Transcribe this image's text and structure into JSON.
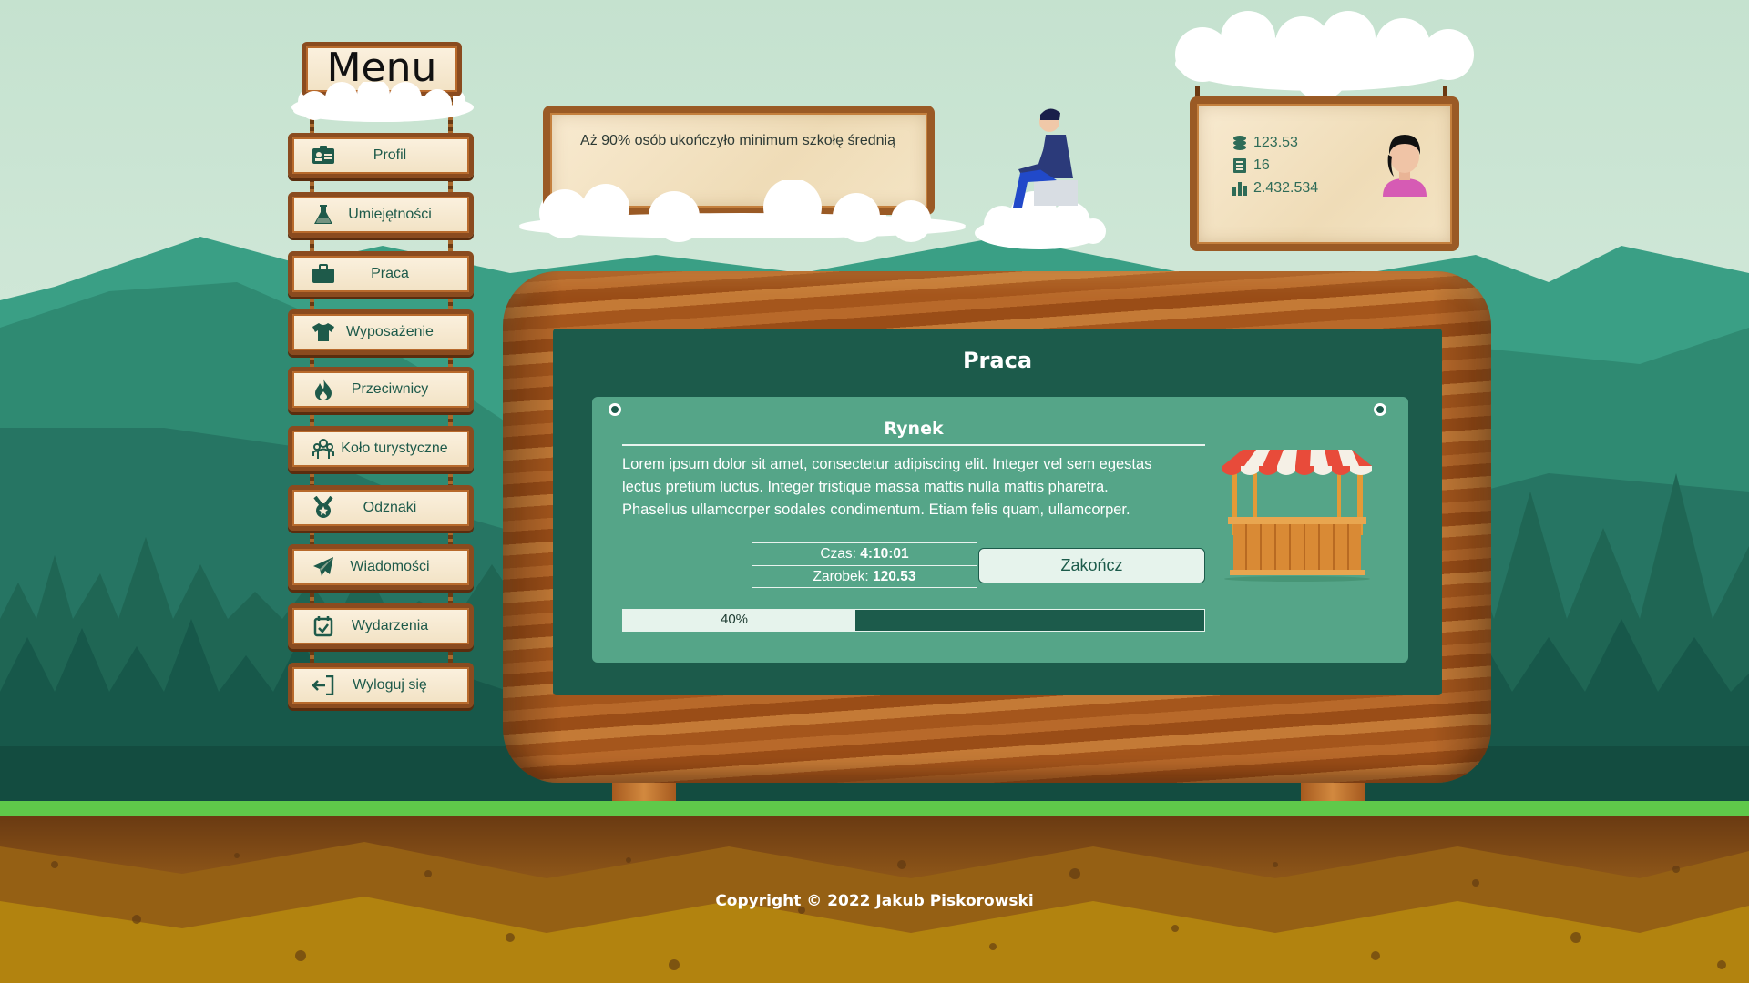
{
  "menu": {
    "title": "Menu",
    "items": [
      {
        "label": "Profil",
        "icon": "id-card-icon"
      },
      {
        "label": "Umiejętności",
        "icon": "flask-icon"
      },
      {
        "label": "Praca",
        "icon": "briefcase-icon"
      },
      {
        "label": "Wyposażenie",
        "icon": "shirt-icon"
      },
      {
        "label": "Przeciwnicy",
        "icon": "fire-icon"
      },
      {
        "label": "Koło turystyczne",
        "icon": "people-group-icon"
      },
      {
        "label": "Odznaki",
        "icon": "medal-icon"
      },
      {
        "label": "Wiadomości",
        "icon": "paper-plane-icon"
      },
      {
        "label": "Wydarzenia",
        "icon": "calendar-check-icon"
      },
      {
        "label": "Wyloguj się",
        "icon": "logout-icon"
      }
    ]
  },
  "tip": {
    "text": "Aż 90% osób ukończyło minimum szkołę średnią"
  },
  "stats": {
    "money": "123.53",
    "level": "16",
    "rank": "2.432.534"
  },
  "main": {
    "title": "Praca",
    "job": {
      "title": "Rynek",
      "description": "Lorem ipsum dolor sit amet, consectetur adipiscing elit. Integer vel sem egestas lectus pretium luctus. Integer tristique massa mattis nulla mattis pharetra. Phasellus ullamcorper sodales condimentum. Etiam felis quam, ullamcorper.",
      "time_label": "Czas:",
      "time_value": "4:10:01",
      "earn_label": "Zarobek:",
      "earn_value": "120.53",
      "finish_button": "Zakończ",
      "progress_text": "40%",
      "progress": 0.4
    }
  },
  "footer": {
    "copyright": "Copyright © 2022 Jakub Piskorowski"
  },
  "colors": {
    "dark_green": "#1c5b4b",
    "card_green": "#55a588",
    "wood": "#a5561c",
    "grass": "#5fc94a"
  }
}
